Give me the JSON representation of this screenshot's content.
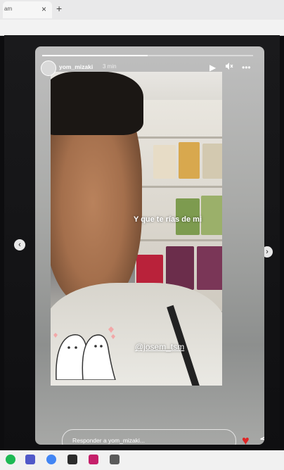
{
  "browser": {
    "tab_label": "am",
    "close_symbol": "×",
    "new_tab_symbol": "+"
  },
  "story": {
    "username": "yom_mizaki",
    "time": "3 min",
    "caption": "Y que te rías de mi",
    "mention": "@josem_tsm",
    "progress_fraction": 0.5
  },
  "reply": {
    "placeholder": "Responder a yom_mizaki..."
  },
  "icons": {
    "prev": "chevron-left-icon",
    "next": "chevron-right-icon",
    "play": "play-icon",
    "mute": "mute-icon",
    "more": "more-icon",
    "heart": "heart-icon",
    "send": "send-icon"
  },
  "colors": {
    "heart": "#e02525"
  },
  "taskbar": {
    "apps": [
      "spotify-icon",
      "teams-icon",
      "chrome-icon",
      "sticky-icon",
      "store-icon",
      "app-icon"
    ]
  }
}
